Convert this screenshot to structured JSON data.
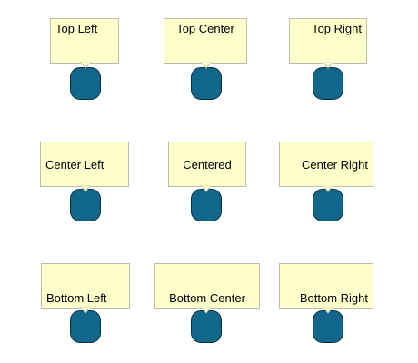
{
  "colors": {
    "tooltip_background": "#ffffcc",
    "tooltip_border": "#bdbdaa",
    "node_fill": "#11678a",
    "node_border": "#0a2f3f"
  },
  "items": [
    {
      "label": "Top Left",
      "alignment": "top-left"
    },
    {
      "label": "Top Center",
      "alignment": "top-center"
    },
    {
      "label": "Top Right",
      "alignment": "top-right"
    },
    {
      "label": "Center Left",
      "alignment": "center-left"
    },
    {
      "label": "Centered",
      "alignment": "center-center"
    },
    {
      "label": "Center Right",
      "alignment": "center-right"
    },
    {
      "label": "Bottom Left",
      "alignment": "bottom-left"
    },
    {
      "label": "Bottom Center",
      "alignment": "bottom-center"
    },
    {
      "label": "Bottom Right",
      "alignment": "bottom-right"
    }
  ]
}
